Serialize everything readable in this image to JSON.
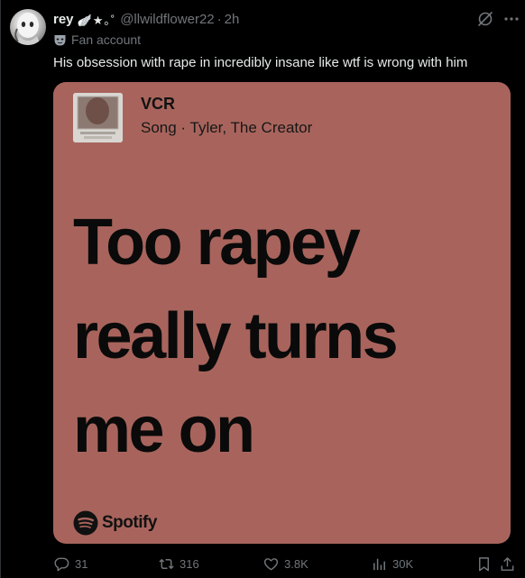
{
  "post": {
    "display_name": "rey",
    "name_decoration": "🪽★｡˚",
    "handle": "@llwildflower22",
    "separator": "·",
    "time": "2h",
    "affiliation": "Fan account",
    "text": "His obsession with rape in incredibly insane like wtf is wrong with him"
  },
  "card": {
    "song_title": "VCR",
    "song_subtitle": "Song · Tyler, The Creator",
    "lyric": "Too rapey\nreally turns\nme on",
    "brand": "Spotify",
    "background_color": "#a8645c"
  },
  "actions": {
    "replies": "31",
    "reposts": "316",
    "likes": "3.8K",
    "views": "30K"
  },
  "icons": {
    "grok": "grok-icon",
    "more": "more-icon",
    "reply": "reply-icon",
    "repost": "repost-icon",
    "like": "heart-icon",
    "views": "views-icon",
    "bookmark": "bookmark-icon",
    "share": "share-icon"
  }
}
